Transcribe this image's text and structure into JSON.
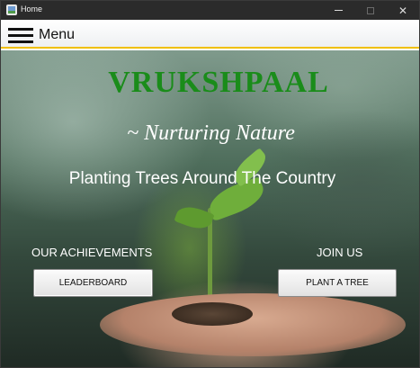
{
  "window": {
    "title": "Home",
    "controls": {
      "minimize": "minimize",
      "maximize": "maximize",
      "close": "✕"
    }
  },
  "menubar": {
    "menu_label": "Menu",
    "accent_color": "#f0c000"
  },
  "hero": {
    "brand": "VRUKSHPAAL",
    "brand_color": "#1a8c1a",
    "tagline": "~ Nurturing Nature",
    "subtitle": "Planting Trees Around The Country"
  },
  "achievements": {
    "label": "OUR ACHIEVEMENTS",
    "button": "LEADERBOARD"
  },
  "join": {
    "label": "JOIN US",
    "button": "PLANT A TREE"
  }
}
